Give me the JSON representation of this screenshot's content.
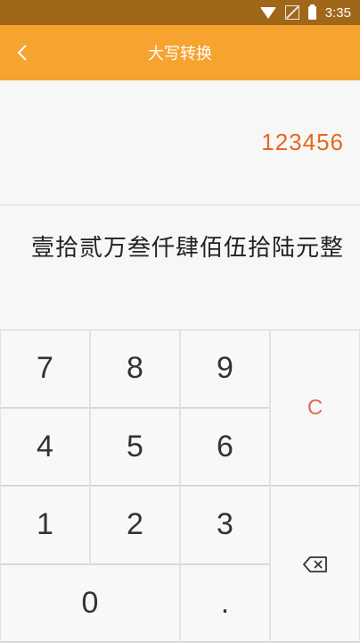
{
  "status": {
    "time": "3:35"
  },
  "header": {
    "title": "大写转换"
  },
  "display": {
    "number": "123456"
  },
  "result": {
    "text": "壹拾贰万叁仟肆佰伍拾陆元整"
  },
  "keys": {
    "k7": "7",
    "k8": "8",
    "k9": "9",
    "k4": "4",
    "k5": "5",
    "k6": "6",
    "k1": "1",
    "k2": "2",
    "k3": "3",
    "k0": "0",
    "dot": ".",
    "clear": "C"
  },
  "icons": {
    "back": "chevron-left-icon",
    "backspace": "backspace-icon",
    "wifi": "wifi-icon",
    "signal": "no-signal-icon",
    "battery": "battery-icon"
  },
  "colors": {
    "status_bar": "#a0661a",
    "title_bar": "#f6a330",
    "number": "#e8661c",
    "clear_key": "#e06b5a"
  }
}
